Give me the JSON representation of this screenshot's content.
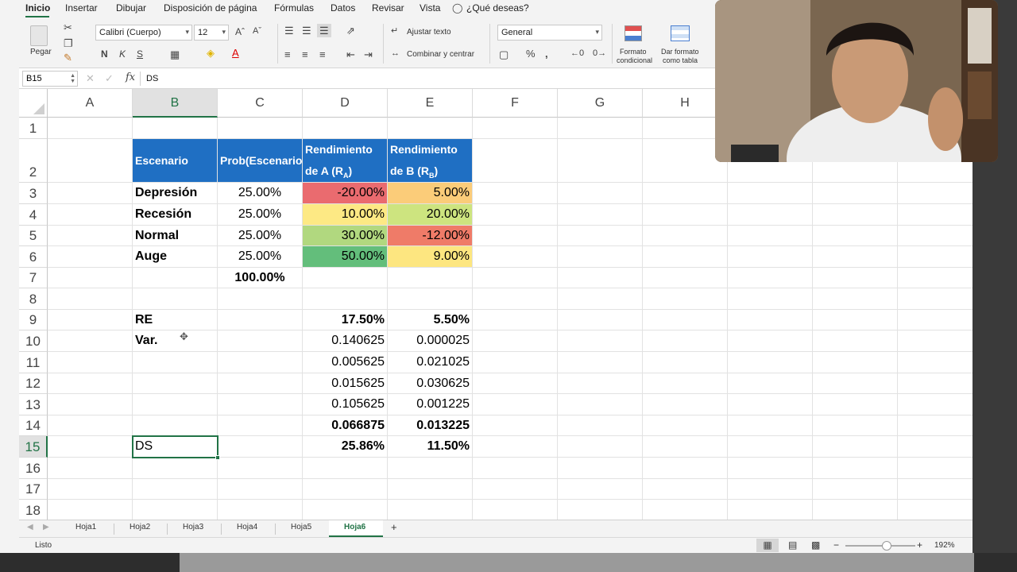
{
  "ribbon_tabs": [
    "Inicio",
    "Insertar",
    "Dibujar",
    "Disposición de página",
    "Fórmulas",
    "Datos",
    "Revisar",
    "Vista"
  ],
  "tell_me": "¿Qué deseas?",
  "clipboard": {
    "paste_label": "Pegar"
  },
  "font": {
    "name": "Calibri (Cuerpo)",
    "size": "12",
    "bold": "N",
    "italic": "K",
    "underline": "S"
  },
  "alignment": {
    "wrap_text": "Ajustar texto",
    "merge_center": "Combinar y centrar"
  },
  "number": {
    "format": "General"
  },
  "styles": {
    "conditional_format": [
      "Formato",
      "condicional"
    ],
    "format_table": [
      "Dar formato",
      "como tabla"
    ]
  },
  "formula_bar": {
    "name_box": "B15",
    "fx": "fx",
    "content": "DS"
  },
  "columns": [
    "A",
    "B",
    "C",
    "D",
    "E",
    "F",
    "G",
    "H"
  ],
  "rows": [
    "1",
    "2",
    "3",
    "4",
    "5",
    "6",
    "7",
    "8",
    "9",
    "10",
    "11",
    "12",
    "13",
    "14",
    "15",
    "16",
    "17",
    "18"
  ],
  "table_header": {
    "scenario": "Escenario",
    "prob": "Prob(Escenario)",
    "ret_a_1": "Rendimiento",
    "ret_a_2": "de A (R",
    "ret_a_sub": "A",
    "ret_a_close": ")",
    "ret_b_1": "Rendimiento",
    "ret_b_2": "de B (R",
    "ret_b_sub": "B",
    "ret_b_close": ")"
  },
  "scenarios": [
    {
      "name": "Depresión",
      "prob": "25.00%",
      "ra": "-20.00%",
      "rb": "5.00%",
      "ra_color": "#ea6b6f",
      "rb_color": "#fbcc79"
    },
    {
      "name": "Recesión",
      "prob": "25.00%",
      "ra": "10.00%",
      "rb": "20.00%",
      "ra_color": "#fde984",
      "rb_color": "#cde47f"
    },
    {
      "name": "Normal",
      "prob": "25.00%",
      "ra": "30.00%",
      "rb": "-12.00%",
      "ra_color": "#b1d87f",
      "rb_color": "#ef7b68"
    },
    {
      "name": "Auge",
      "prob": "25.00%",
      "ra": "50.00%",
      "rb": "9.00%",
      "ra_color": "#63be7b",
      "rb_color": "#fde680"
    }
  ],
  "prob_total": "100.00%",
  "re": {
    "label": "RE",
    "a": "17.50%",
    "b": "5.50%"
  },
  "var": {
    "label": "Var.",
    "rows": [
      {
        "a": "0.140625",
        "b": "0.000025"
      },
      {
        "a": "0.005625",
        "b": "0.021025"
      },
      {
        "a": "0.015625",
        "b": "0.030625"
      },
      {
        "a": "0.105625",
        "b": "0.001225"
      }
    ],
    "total": {
      "a": "0.066875",
      "b": "0.013225"
    }
  },
  "ds": {
    "label": "DS",
    "a": "25.86%",
    "b": "11.50%"
  },
  "sheets": [
    "Hoja1",
    "Hoja2",
    "Hoja3",
    "Hoja4",
    "Hoja5",
    "Hoja6"
  ],
  "active_sheet": "Hoja6",
  "status": {
    "ready": "Listo",
    "zoom": "192%"
  },
  "colors": {
    "accent": "#217346",
    "header_blue": "#1f6fc3"
  }
}
